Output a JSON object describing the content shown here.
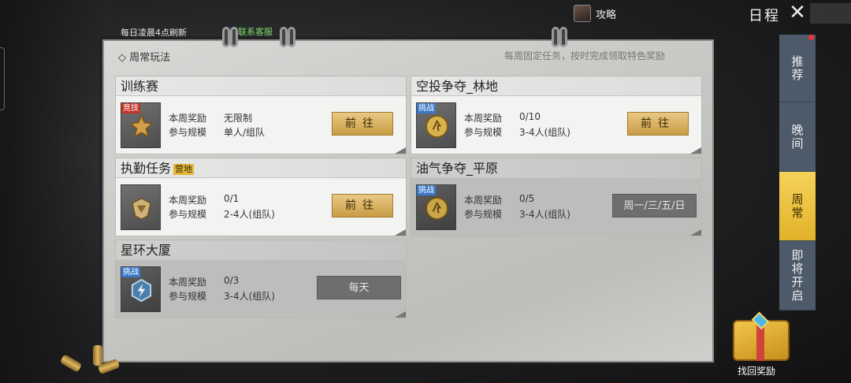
{
  "header": {
    "guide_label": "攻略",
    "schedule_title": "日程",
    "refresh_note": "每日凌晨4点刷新",
    "contact_link": "联系客服"
  },
  "board": {
    "section_title": "◇ 周常玩法",
    "section_note": "每周固定任务，按时完成领取特色奖励",
    "reward_label": "本周奖励",
    "size_label": "参与规模",
    "cards": [
      {
        "title": "训练赛",
        "badge": "竞技",
        "reward": "无限制",
        "size": "单人/组队",
        "action": "前往",
        "status": "active"
      },
      {
        "title": "空投争夺_林地",
        "badge": "挑战",
        "reward": "0/10",
        "size": "3-4人(组队)",
        "action": "前往",
        "status": "active"
      },
      {
        "title": "执勤任务",
        "title_tag": "营地",
        "badge": "",
        "reward": "0/1",
        "size": "2-4人(组队)",
        "action": "前往",
        "status": "active"
      },
      {
        "title": "油气争夺_平原",
        "badge": "挑战",
        "reward": "0/5",
        "size": "3-4人(组队)",
        "action": "周一/三/五/日",
        "status": "inactive"
      },
      {
        "title": "星环大厦",
        "badge": "挑战",
        "reward": "0/3",
        "size": "3-4人(组队)",
        "action": "每天",
        "status": "inactive"
      }
    ]
  },
  "tabs": [
    {
      "label": "推荐",
      "active": false
    },
    {
      "label": "晚间",
      "active": false
    },
    {
      "label": "周常",
      "active": true
    },
    {
      "label": "即将开启",
      "active": false
    }
  ],
  "reward_chest_label": "找回奖励",
  "colors": {
    "go_button": "#d9b262",
    "active_tab": "#e9c23a",
    "tab_bg": "#4d5a6a",
    "contact": "#7fdc6a"
  }
}
